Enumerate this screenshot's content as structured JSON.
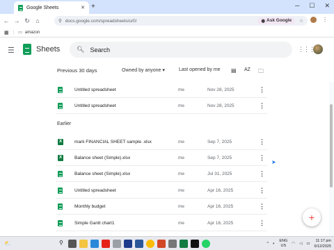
{
  "browser": {
    "tab_title": "Google Sheets",
    "url": "docs.google.com/spreadsheets/u/0/",
    "ask_google": "Ask Google",
    "bookmark": "amazon"
  },
  "app": {
    "title": "Sheets",
    "search_placeholder": "Search"
  },
  "filters": {
    "period": "Previous 30 days",
    "owner": "Owned by anyone",
    "sort": "Last opened by me",
    "sort_icon_text": "AZ"
  },
  "section_earlier": "Earlier",
  "rows": [
    {
      "type": "sheet",
      "name": "Untitled spreadsheet",
      "owner": "me",
      "date": "Nov 28, 2025"
    },
    {
      "type": "sheet",
      "name": "Untitled spreadsheet",
      "owner": "me",
      "date": "Nov 28, 2025"
    },
    {
      "type": "xls",
      "name": "mark FINANCIAL SHEET sample .xlsx",
      "owner": "me",
      "date": "Sep 7, 2025"
    },
    {
      "type": "xls",
      "name": "Balance sheet (Simple).xlsx",
      "owner": "me",
      "date": "Sep 7, 2025"
    },
    {
      "type": "sheet",
      "name": "Balance sheet (Simple).xlsx",
      "owner": "me",
      "date": "Jul 31, 2025"
    },
    {
      "type": "sheet",
      "name": "Untitled spreadsheet",
      "owner": "me",
      "date": "Apr 16, 2025"
    },
    {
      "type": "sheet",
      "name": "Monthly budget",
      "owner": "me",
      "date": "Apr 16, 2025"
    },
    {
      "type": "sheet",
      "name": "Simple Gantt chart1",
      "owner": "me",
      "date": "Apr 16, 2025"
    }
  ],
  "taskbar": {
    "lang": "ENG",
    "region": "US",
    "time": "11:17 pm",
    "date": "6/12/2025"
  },
  "colors": {
    "sheets_green": "#0f9d58",
    "excel_green": "#107c41",
    "tab_strip": "#d3e3fd"
  }
}
